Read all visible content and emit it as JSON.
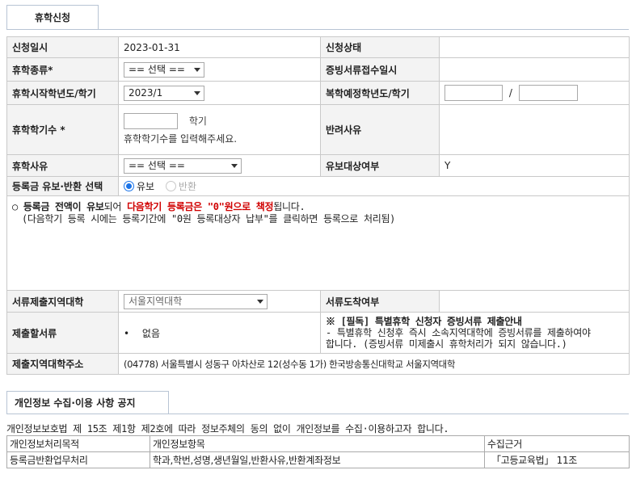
{
  "tab": {
    "label": "휴학신청"
  },
  "form": {
    "apply_date_label": "신청일시",
    "apply_date_value": "2023-01-31",
    "apply_status_label": "신청상태",
    "apply_status_value": "",
    "leave_type_label": "휴학종류*",
    "leave_type_select": "== 선택 ==",
    "doc_receipt_date_label": "증빙서류접수일시",
    "doc_receipt_date_value": "",
    "start_term_label": "휴학시작학년도/학기",
    "start_term_select": "2023/1",
    "return_term_label": "복학예정학년도/학기",
    "return_term_sep": "/",
    "period_label": "휴학학기수 *",
    "period_unit": "학기",
    "period_help": "휴학학기수를 입력해주세요.",
    "reject_reason_label": "반려사유",
    "reject_reason_value": "",
    "reason_label": "휴학사유",
    "reason_select": "== 선택 ==",
    "defer_target_label": "유보대상여부",
    "defer_target_value": "Y",
    "tuition_choice_label": "등록금 유보·반환 선택",
    "option_defer": "유보",
    "option_refund": "반환",
    "notice": {
      "bullet": "○",
      "part1": "등록금 전액이 유보",
      "part2": "되어 ",
      "part3": "다음학기 등록금은 \"0\"원으로 책정",
      "part4": "됩니다.",
      "line2": "(다음학기 등록 시에는 등록기간에 \"0원 등록대상자 납부\"를 클릭하면 등록으로 처리됨)"
    },
    "region_label": "서류제출지역대학",
    "region_select": "서울지역대학",
    "doc_arrival_label": "서류도착여부",
    "doc_arrival_value": "",
    "docs_label": "제출할서류",
    "docs_bullet": "•",
    "docs_value": "없음",
    "required_notice_title": "※ [필독] 특별휴학 신청자 증빙서류 제출안내",
    "required_notice_line1": "- 특별휴학 신청후 즉시 소속지역대학에 증빙서류를 제출하여야",
    "required_notice_line2": "합니다. (증빙서류 미제출시 휴학처리가 되지 않습니다.)",
    "address_label": "제출지역대학주소",
    "address_value": "(04778) 서울특별시 성동구 아차산로 12(성수동 1가) 한국방송통신대학교 서울지역대학"
  },
  "privacy": {
    "tab_label": "개인정보 수집·이용 사항 공지",
    "desc": "개인정보보호법 제 15조 제1항 제2호에 따라 정보주체의 동의 없이 개인정보를 수집·이용하고자 합니다.",
    "headers": [
      "개인정보처리목적",
      "개인정보항목",
      "수집근거"
    ],
    "rows": [
      [
        "등록금반환업무처리",
        "학과,학번,성명,생년월일,반환사유,반환계좌정보",
        "「고등교육법」 11조"
      ]
    ]
  }
}
